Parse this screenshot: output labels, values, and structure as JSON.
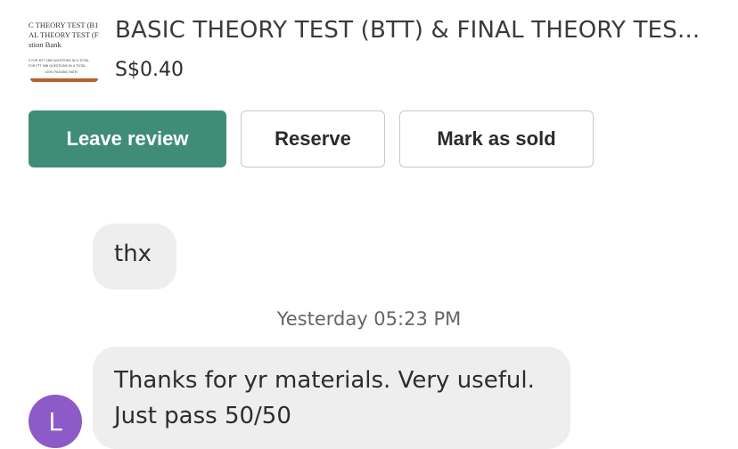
{
  "listing": {
    "thumbnail_lines": [
      "C THEORY TEST (B1",
      "AL THEORY TEST (F1",
      "stion Bank"
    ],
    "thumbnail_small_lines": [
      "5 FOR BTT 288 QUESTIONS IN A TOTAL",
      "FOR FTT 568 QUESTIONS IN A TOTAL",
      "100% PASSING RATE!"
    ],
    "title": "BASIC THEORY TEST (BTT) & FINAL THEORY TES...",
    "price": "S$0.40"
  },
  "actions": {
    "leave_review": "Leave review",
    "reserve": "Reserve",
    "mark_as_sold": "Mark as sold"
  },
  "colors": {
    "primary": "#3f8d77",
    "avatar": "#8e5ac8",
    "bubble": "#eeeeee"
  },
  "messages": [
    {
      "text": "thx"
    },
    {
      "timestamp": "Yesterday 05:23 PM"
    },
    {
      "line1": "Thanks for yr materials. Very useful.",
      "line2": "Just pass 50/50",
      "avatar_initial": "L"
    }
  ]
}
